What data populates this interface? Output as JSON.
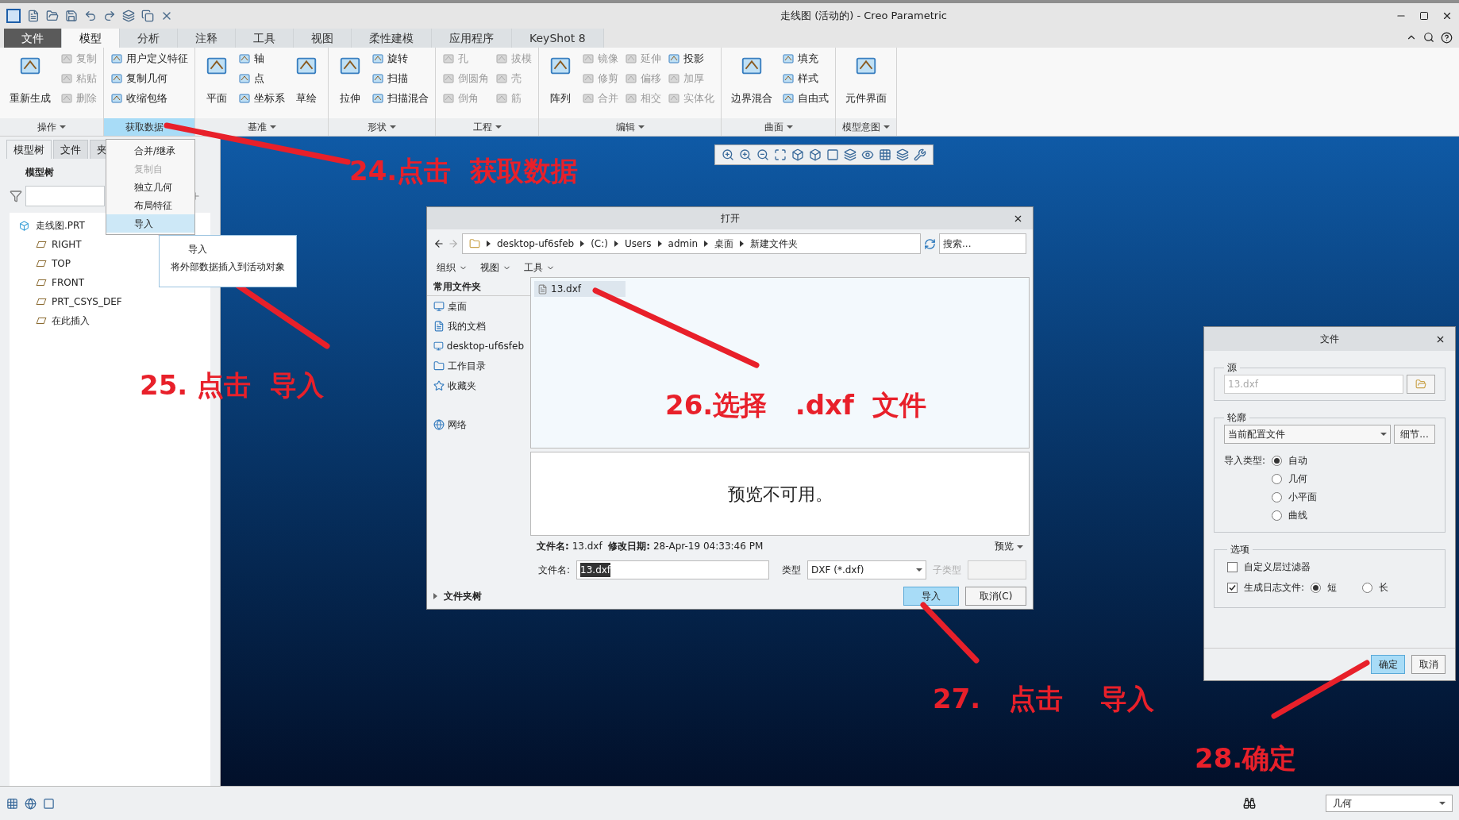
{
  "window": {
    "title": "走线图 (活动的) - Creo Parametric"
  },
  "ribbon_tabs": [
    {
      "label": "文件",
      "kind": "file",
      "selected": false
    },
    {
      "label": "模型",
      "kind": "tab",
      "selected": true
    },
    {
      "label": "分析",
      "kind": "tab",
      "selected": false
    },
    {
      "label": "注释",
      "kind": "tab",
      "selected": false
    },
    {
      "label": "工具",
      "kind": "tab",
      "selected": false
    },
    {
      "label": "视图",
      "kind": "tab",
      "selected": false
    },
    {
      "label": "柔性建模",
      "kind": "tab",
      "selected": false
    },
    {
      "label": "应用程序",
      "kind": "tab",
      "selected": false
    },
    {
      "label": "KeyShot 8",
      "kind": "tab",
      "selected": false
    }
  ],
  "ribbon_groups": [
    {
      "label": "操作",
      "selected": false,
      "items": [
        {
          "label": "重新生成",
          "kind": "large",
          "disabled": false
        },
        {
          "label": "复制",
          "kind": "small",
          "disabled": true
        },
        {
          "label": "粘贴",
          "kind": "small",
          "disabled": true
        },
        {
          "label": "删除",
          "kind": "small",
          "disabled": true
        }
      ]
    },
    {
      "label": "获取数据",
      "selected": true,
      "items": [
        {
          "label": "用户定义特征",
          "kind": "small",
          "disabled": false
        },
        {
          "label": "复制几何",
          "kind": "small",
          "disabled": false
        },
        {
          "label": "收缩包络",
          "kind": "small",
          "disabled": false
        }
      ]
    },
    {
      "label": "基准",
      "selected": false,
      "items": [
        {
          "label": "平面",
          "kind": "large",
          "disabled": false
        },
        {
          "label": "轴",
          "kind": "small",
          "disabled": false
        },
        {
          "label": "点",
          "kind": "small",
          "disabled": false
        },
        {
          "label": "坐标系",
          "kind": "small",
          "disabled": false
        },
        {
          "label": "草绘",
          "kind": "large",
          "disabled": false
        }
      ]
    },
    {
      "label": "形状",
      "selected": false,
      "items": [
        {
          "label": "拉伸",
          "kind": "large",
          "disabled": false
        },
        {
          "label": "旋转",
          "kind": "small",
          "disabled": false
        },
        {
          "label": "扫描",
          "kind": "small",
          "disabled": false
        },
        {
          "label": "扫描混合",
          "kind": "small",
          "disabled": false
        }
      ]
    },
    {
      "label": "工程",
      "selected": false,
      "items": [
        {
          "label": "孔",
          "kind": "small",
          "disabled": true
        },
        {
          "label": "倒圆角",
          "kind": "small",
          "disabled": true
        },
        {
          "label": "倒角",
          "kind": "small",
          "disabled": true
        },
        {
          "label": "拔模",
          "kind": "small",
          "disabled": true
        },
        {
          "label": "壳",
          "kind": "small",
          "disabled": true
        },
        {
          "label": "筋",
          "kind": "small",
          "disabled": true
        }
      ]
    },
    {
      "label": "编辑",
      "selected": false,
      "items": [
        {
          "label": "阵列",
          "kind": "large",
          "disabled": false
        },
        {
          "label": "镜像",
          "kind": "small",
          "disabled": true
        },
        {
          "label": "修剪",
          "kind": "small",
          "disabled": true
        },
        {
          "label": "合并",
          "kind": "small",
          "disabled": true
        },
        {
          "label": "延伸",
          "kind": "small",
          "disabled": true
        },
        {
          "label": "偏移",
          "kind": "small",
          "disabled": true
        },
        {
          "label": "相交",
          "kind": "small",
          "disabled": true
        },
        {
          "label": "投影",
          "kind": "small",
          "disabled": false
        },
        {
          "label": "加厚",
          "kind": "small",
          "disabled": true
        },
        {
          "label": "实体化",
          "kind": "small",
          "disabled": true
        }
      ]
    },
    {
      "label": "曲面",
      "selected": false,
      "items": [
        {
          "label": "边界混合",
          "kind": "large",
          "disabled": false
        },
        {
          "label": "填充",
          "kind": "small",
          "disabled": false
        },
        {
          "label": "样式",
          "kind": "small",
          "disabled": false
        },
        {
          "label": "自由式",
          "kind": "small",
          "disabled": false
        }
      ]
    },
    {
      "label": "模型意图",
      "selected": false,
      "items": [
        {
          "label": "元件界面",
          "kind": "large",
          "disabled": false
        }
      ]
    }
  ],
  "left_panel": {
    "tabs": [
      {
        "label": "模型树",
        "selected": true
      },
      {
        "label": "文件",
        "selected": false
      },
      {
        "label": "夹",
        "selected": false
      }
    ],
    "heading": "模型树",
    "tree": [
      {
        "label": "走线图.PRT",
        "children": [
          {
            "label": "RIGHT"
          },
          {
            "label": "TOP"
          },
          {
            "label": "FRONT"
          },
          {
            "label": "PRT_CSYS_DEF"
          },
          {
            "label": "在此插入"
          }
        ]
      }
    ]
  },
  "get_data_menu": {
    "items": [
      {
        "label": "合并/继承",
        "disabled": false,
        "selected": false
      },
      {
        "label": "复制自",
        "disabled": true,
        "selected": false
      },
      {
        "label": "独立几何",
        "disabled": false,
        "selected": false
      },
      {
        "label": "布局特征",
        "disabled": false,
        "selected": false
      },
      {
        "label": "导入",
        "disabled": false,
        "selected": true
      }
    ],
    "tooltip": {
      "title": "导入",
      "description": "将外部数据插入到活动对象"
    }
  },
  "open_dialog": {
    "title": "打开",
    "path": [
      "desktop-uf6sfeb",
      "(C:)",
      "Users",
      "admin",
      "桌面",
      "新建文件夹"
    ],
    "search_placeholder": "搜索...",
    "toolbar": [
      "组织",
      "视图",
      "工具"
    ],
    "sidebar_heading": "常用文件夹",
    "sidebar": [
      "桌面",
      "我的文档",
      "desktop-uf6sfeb",
      "工作目录",
      "收藏夹",
      "网络"
    ],
    "files": [
      {
        "name": "13.dxf",
        "selected": true
      }
    ],
    "preview_text": "预览不可用。",
    "file_info": "**文件名:** 13.dxf  **修改日期:** 28-Apr-19 04:33:46 PM",
    "preview_menu": "预览",
    "filename_label": "文件名:",
    "filename": "13.dxf",
    "type_label": "类型",
    "type": "DXF (*.dxf)",
    "subtype_label": "子类型",
    "folder_tree": "文件夹树",
    "buttons": [
      {
        "label": "导入",
        "primary": true
      },
      {
        "label": "取消(C)",
        "primary": false
      }
    ]
  },
  "file_dialog": {
    "title": "文件",
    "source_label": "源",
    "source": "13.dxf",
    "profile_label": "轮廓",
    "profile": "当前配置文件",
    "details_button": "细节...",
    "import_type_label": "导入类型:",
    "import_types": [
      {
        "label": "自动",
        "selected": true
      },
      {
        "label": "几何",
        "selected": false
      },
      {
        "label": "小平面",
        "selected": false
      },
      {
        "label": "曲线",
        "selected": false
      }
    ],
    "options_label": "选项",
    "layer_filter": {
      "label": "自定义层过滤器",
      "checked": false
    },
    "log_file": {
      "label": "生成日志文件:",
      "checked": true
    },
    "log_levels": [
      {
        "label": "短",
        "selected": true
      },
      {
        "label": "长",
        "selected": false
      }
    ],
    "buttons": [
      {
        "label": "确定",
        "primary": true
      },
      {
        "label": "取消",
        "primary": false
      }
    ]
  },
  "status_bar": {
    "filter": "几何"
  },
  "annotations": [
    {
      "text": "24.点击  获取数据"
    },
    {
      "text": "25. 点击  导入"
    },
    {
      "text": "26.选择   .dxf  文件"
    },
    {
      "text": "27.   点击    导入"
    },
    {
      "text": "28.确定"
    }
  ]
}
